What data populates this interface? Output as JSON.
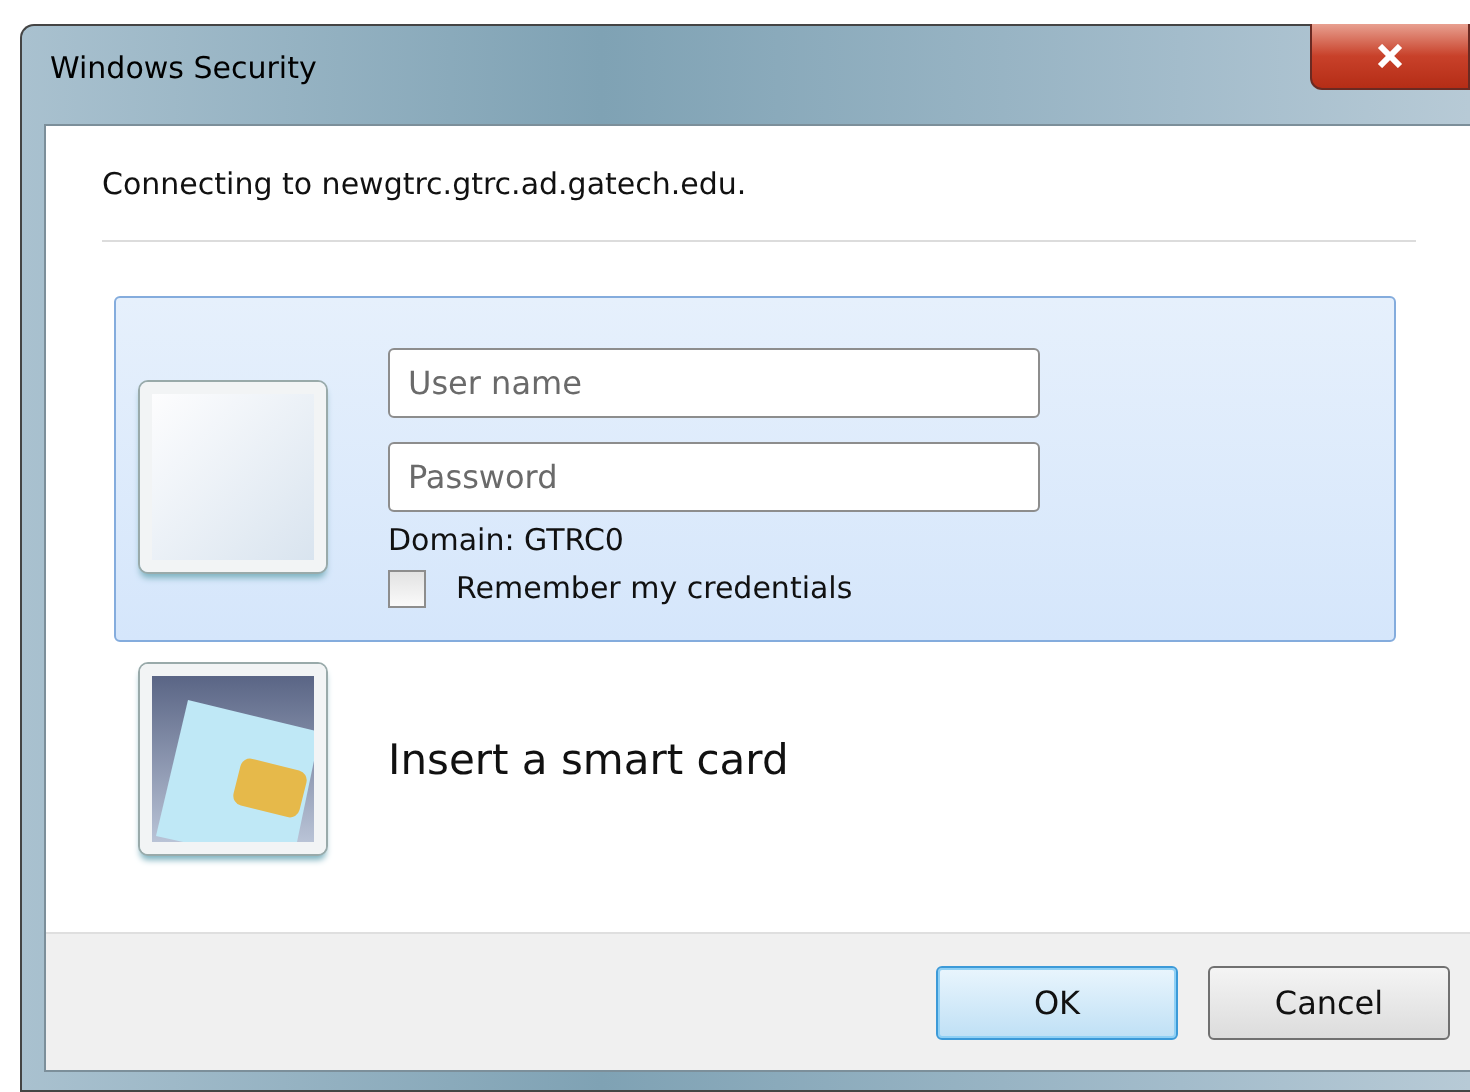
{
  "window": {
    "title": "Windows Security"
  },
  "message": "Connecting to newgtrc.gtrc.ad.gatech.edu.",
  "options": [
    {
      "kind": "credential",
      "selected": true,
      "username": {
        "placeholder": "User name"
      },
      "password": {
        "placeholder": "Password"
      },
      "domain": "Domain: GTRC0",
      "remember": {
        "label": "Remember my credentials",
        "checked": false
      }
    },
    {
      "kind": "smartcard",
      "selected": false,
      "label": "Insert a smart card"
    }
  ],
  "buttons": [
    {
      "label": "OK",
      "default": true
    },
    {
      "label": "Cancel",
      "default": false
    }
  ]
}
